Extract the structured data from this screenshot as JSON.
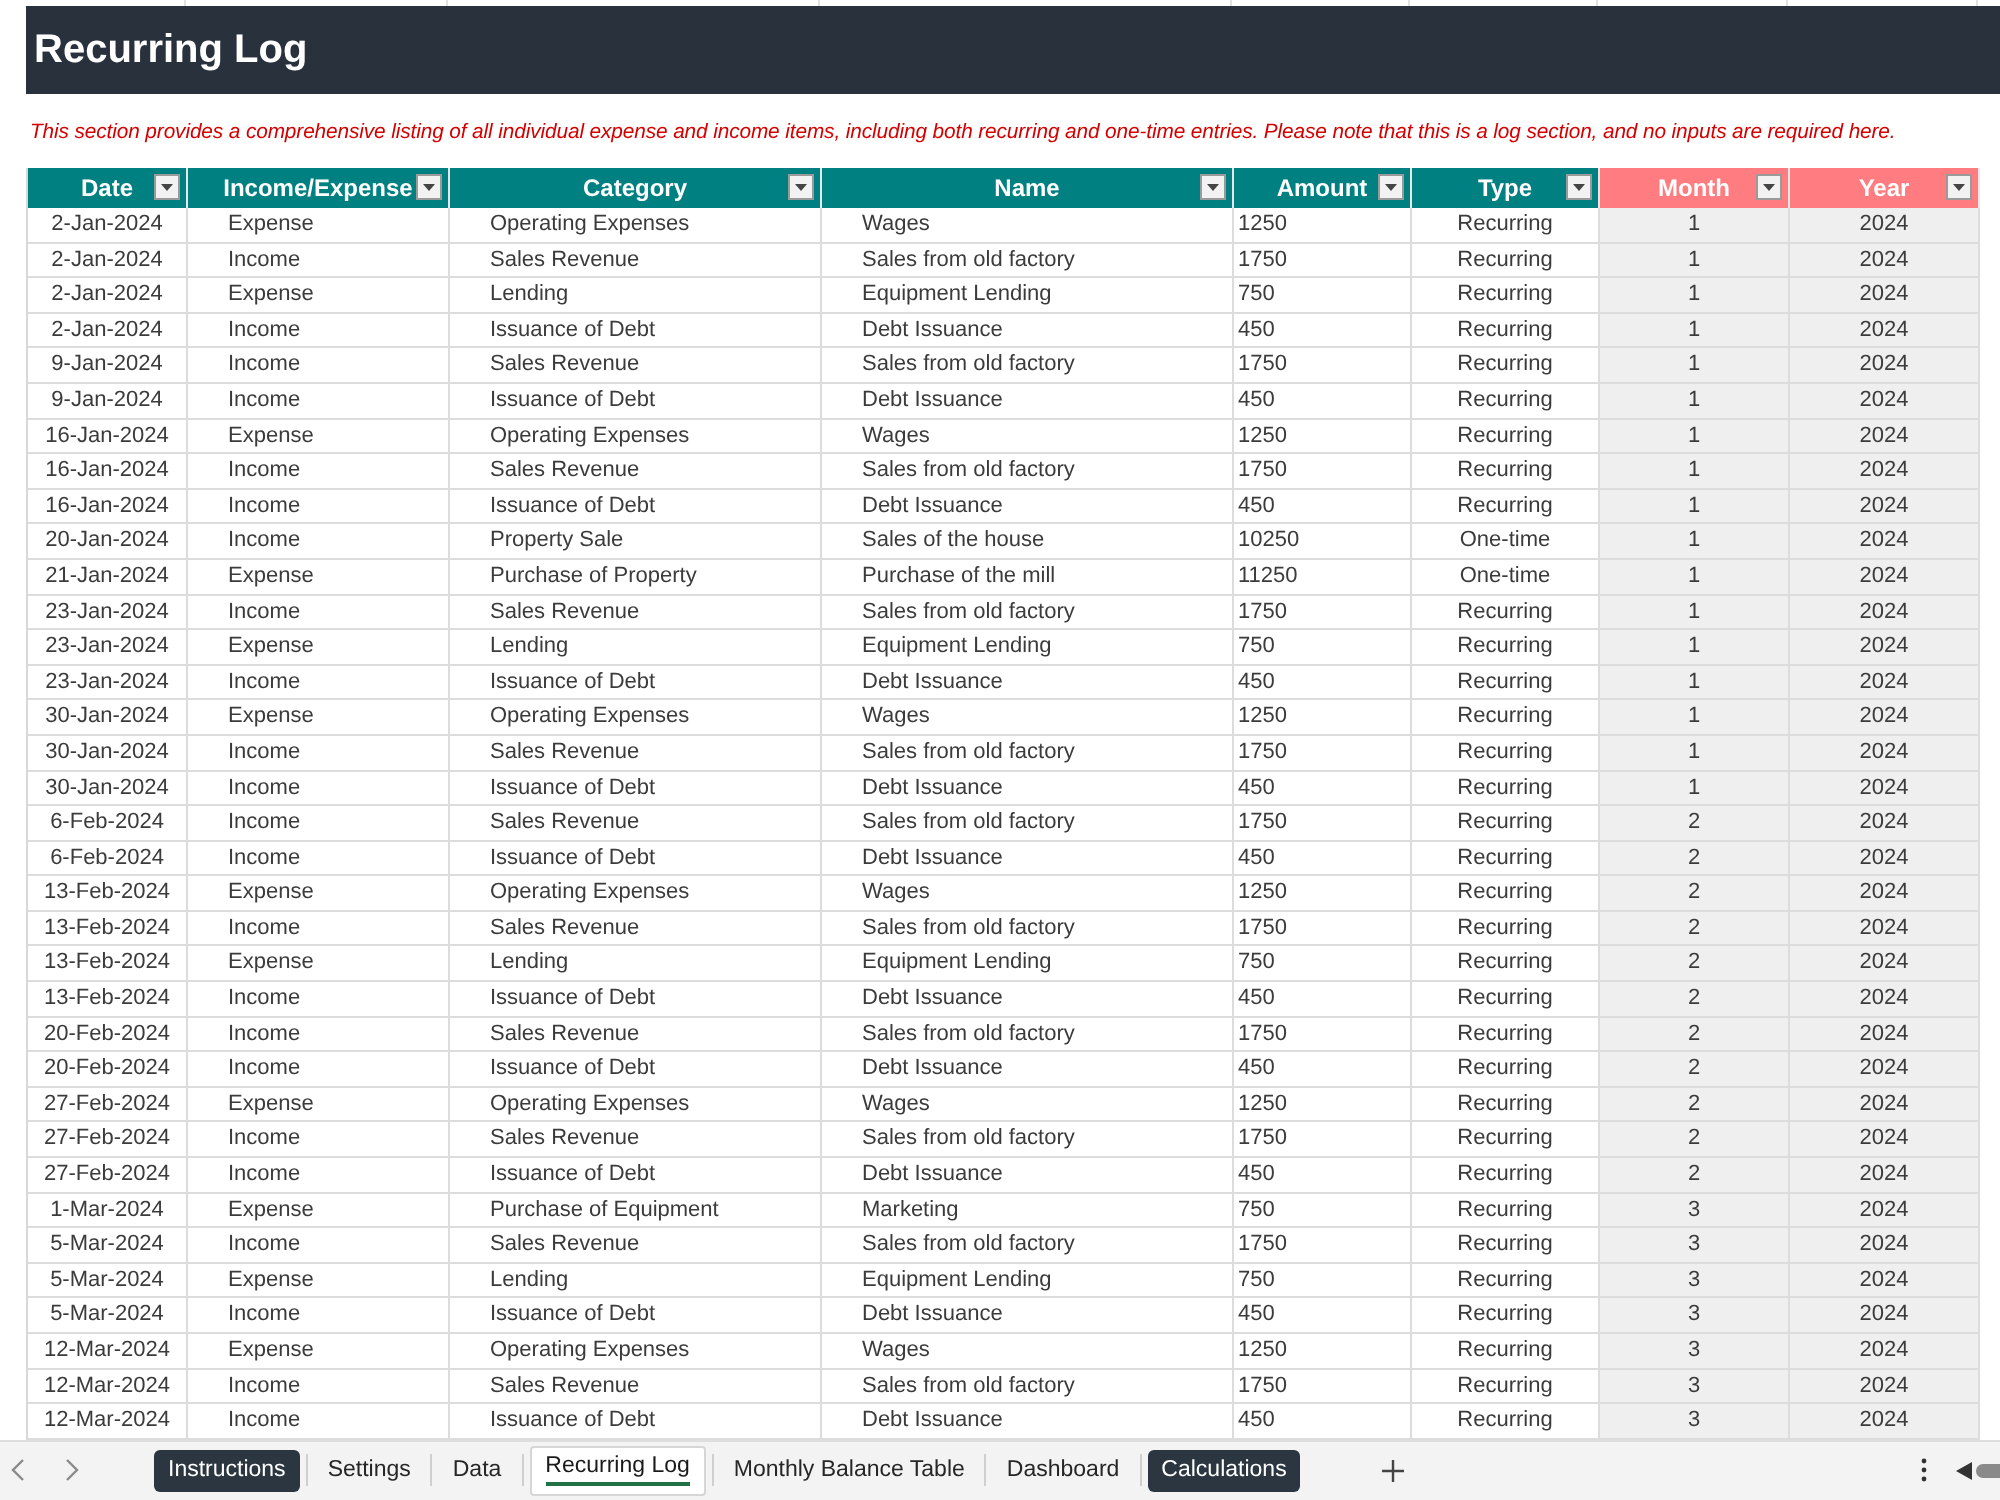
{
  "title_bar": {
    "title": "Recurring Log"
  },
  "note": "This section provides a comprehensive listing of all individual expense and income items, including both recurring and one-time entries. Please note that this is a log section, and no inputs are required here.",
  "table": {
    "columns": [
      {
        "label": "Date",
        "kind": "date",
        "color": "#008080"
      },
      {
        "label": "Income/Expense",
        "kind": "text",
        "color": "#008080"
      },
      {
        "label": "Category",
        "kind": "text",
        "color": "#008080"
      },
      {
        "label": "Name",
        "kind": "text",
        "color": "#008080"
      },
      {
        "label": "Amount",
        "kind": "amount",
        "color": "#008080"
      },
      {
        "label": "Type",
        "kind": "choice",
        "color": "#008080"
      },
      {
        "label": "Month",
        "kind": "calculated",
        "color": "#ff7c80"
      },
      {
        "label": "Year",
        "kind": "calculated",
        "color": "#ff7c80"
      }
    ],
    "rows": [
      [
        "2-Jan-2024",
        "Expense",
        "Operating Expenses",
        "Wages",
        "1250",
        "Recurring",
        "1",
        "2024"
      ],
      [
        "2-Jan-2024",
        "Income",
        "Sales Revenue",
        "Sales from old factory",
        "1750",
        "Recurring",
        "1",
        "2024"
      ],
      [
        "2-Jan-2024",
        "Expense",
        "Lending",
        "Equipment Lending",
        "750",
        "Recurring",
        "1",
        "2024"
      ],
      [
        "2-Jan-2024",
        "Income",
        "Issuance of Debt",
        "Debt Issuance",
        "450",
        "Recurring",
        "1",
        "2024"
      ],
      [
        "9-Jan-2024",
        "Income",
        "Sales Revenue",
        "Sales from old factory",
        "1750",
        "Recurring",
        "1",
        "2024"
      ],
      [
        "9-Jan-2024",
        "Income",
        "Issuance of Debt",
        "Debt Issuance",
        "450",
        "Recurring",
        "1",
        "2024"
      ],
      [
        "16-Jan-2024",
        "Expense",
        "Operating Expenses",
        "Wages",
        "1250",
        "Recurring",
        "1",
        "2024"
      ],
      [
        "16-Jan-2024",
        "Income",
        "Sales Revenue",
        "Sales from old factory",
        "1750",
        "Recurring",
        "1",
        "2024"
      ],
      [
        "16-Jan-2024",
        "Income",
        "Issuance of Debt",
        "Debt Issuance",
        "450",
        "Recurring",
        "1",
        "2024"
      ],
      [
        "20-Jan-2024",
        "Income",
        "Property Sale",
        "Sales of the house",
        "10250",
        "One-time",
        "1",
        "2024"
      ],
      [
        "21-Jan-2024",
        "Expense",
        "Purchase of Property",
        "Purchase of the mill",
        "11250",
        "One-time",
        "1",
        "2024"
      ],
      [
        "23-Jan-2024",
        "Income",
        "Sales Revenue",
        "Sales from old factory",
        "1750",
        "Recurring",
        "1",
        "2024"
      ],
      [
        "23-Jan-2024",
        "Expense",
        "Lending",
        "Equipment Lending",
        "750",
        "Recurring",
        "1",
        "2024"
      ],
      [
        "23-Jan-2024",
        "Income",
        "Issuance of Debt",
        "Debt Issuance",
        "450",
        "Recurring",
        "1",
        "2024"
      ],
      [
        "30-Jan-2024",
        "Expense",
        "Operating Expenses",
        "Wages",
        "1250",
        "Recurring",
        "1",
        "2024"
      ],
      [
        "30-Jan-2024",
        "Income",
        "Sales Revenue",
        "Sales from old factory",
        "1750",
        "Recurring",
        "1",
        "2024"
      ],
      [
        "30-Jan-2024",
        "Income",
        "Issuance of Debt",
        "Debt Issuance",
        "450",
        "Recurring",
        "1",
        "2024"
      ],
      [
        "6-Feb-2024",
        "Income",
        "Sales Revenue",
        "Sales from old factory",
        "1750",
        "Recurring",
        "2",
        "2024"
      ],
      [
        "6-Feb-2024",
        "Income",
        "Issuance of Debt",
        "Debt Issuance",
        "450",
        "Recurring",
        "2",
        "2024"
      ],
      [
        "13-Feb-2024",
        "Expense",
        "Operating Expenses",
        "Wages",
        "1250",
        "Recurring",
        "2",
        "2024"
      ],
      [
        "13-Feb-2024",
        "Income",
        "Sales Revenue",
        "Sales from old factory",
        "1750",
        "Recurring",
        "2",
        "2024"
      ],
      [
        "13-Feb-2024",
        "Expense",
        "Lending",
        "Equipment Lending",
        "750",
        "Recurring",
        "2",
        "2024"
      ],
      [
        "13-Feb-2024",
        "Income",
        "Issuance of Debt",
        "Debt Issuance",
        "450",
        "Recurring",
        "2",
        "2024"
      ],
      [
        "20-Feb-2024",
        "Income",
        "Sales Revenue",
        "Sales from old factory",
        "1750",
        "Recurring",
        "2",
        "2024"
      ],
      [
        "20-Feb-2024",
        "Income",
        "Issuance of Debt",
        "Debt Issuance",
        "450",
        "Recurring",
        "2",
        "2024"
      ],
      [
        "27-Feb-2024",
        "Expense",
        "Operating Expenses",
        "Wages",
        "1250",
        "Recurring",
        "2",
        "2024"
      ],
      [
        "27-Feb-2024",
        "Income",
        "Sales Revenue",
        "Sales from old factory",
        "1750",
        "Recurring",
        "2",
        "2024"
      ],
      [
        "27-Feb-2024",
        "Income",
        "Issuance of Debt",
        "Debt Issuance",
        "450",
        "Recurring",
        "2",
        "2024"
      ],
      [
        "1-Mar-2024",
        "Expense",
        "Purchase of Equipment",
        "Marketing",
        "750",
        "Recurring",
        "3",
        "2024"
      ],
      [
        "5-Mar-2024",
        "Income",
        "Sales Revenue",
        "Sales from old factory",
        "1750",
        "Recurring",
        "3",
        "2024"
      ],
      [
        "5-Mar-2024",
        "Expense",
        "Lending",
        "Equipment Lending",
        "750",
        "Recurring",
        "3",
        "2024"
      ],
      [
        "5-Mar-2024",
        "Income",
        "Issuance of Debt",
        "Debt Issuance",
        "450",
        "Recurring",
        "3",
        "2024"
      ],
      [
        "12-Mar-2024",
        "Expense",
        "Operating Expenses",
        "Wages",
        "1250",
        "Recurring",
        "3",
        "2024"
      ],
      [
        "12-Mar-2024",
        "Income",
        "Sales Revenue",
        "Sales from old factory",
        "1750",
        "Recurring",
        "3",
        "2024"
      ],
      [
        "12-Mar-2024",
        "Income",
        "Issuance of Debt",
        "Debt Issuance",
        "450",
        "Recurring",
        "3",
        "2024"
      ]
    ]
  },
  "sheet_tabs": [
    {
      "label": "Instructions",
      "selected": false,
      "color": "#2b3640"
    },
    {
      "label": "Settings",
      "selected": false
    },
    {
      "label": "Data",
      "selected": false
    },
    {
      "label": "Recurring Log",
      "selected": true
    },
    {
      "label": "Monthly Balance Table",
      "selected": false
    },
    {
      "label": "Dashboard",
      "selected": false
    },
    {
      "label": "Calculations",
      "selected": false,
      "color": "#2b3640"
    }
  ]
}
